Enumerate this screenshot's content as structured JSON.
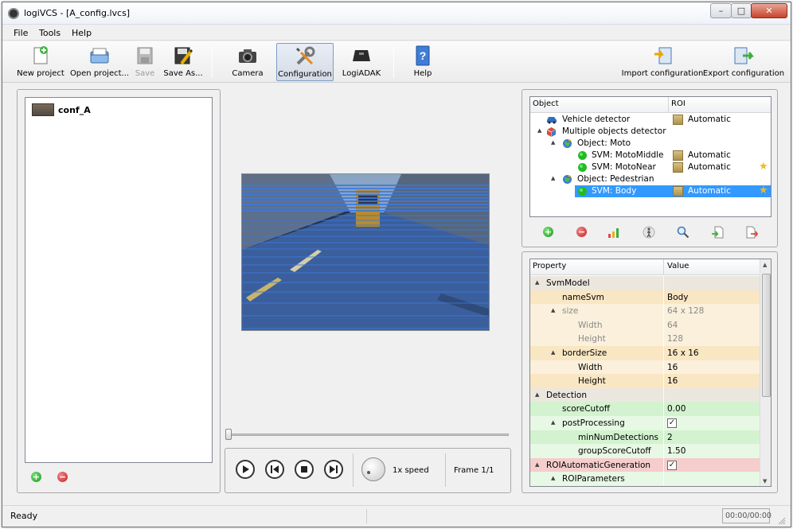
{
  "window": {
    "title": "logiVCS - [A_config.lvcs]",
    "minimize": "–",
    "maximize": "□",
    "close": "✕"
  },
  "menu": [
    "File",
    "Tools",
    "Help"
  ],
  "toolbar": {
    "new_project": "New project",
    "open_project": "Open project...",
    "save": "Save",
    "save_as": "Save As...",
    "camera": "Camera",
    "configuration": "Configuration",
    "logiadak": "LogiADAK",
    "help": "Help",
    "import_configuration": "Import configuration",
    "export_configuration": "Export configuration"
  },
  "projects": {
    "items": [
      {
        "label": "conf_A"
      }
    ]
  },
  "player": {
    "speed_label": "1x speed",
    "frame_label": "Frame 1/1",
    "slider_position": 0
  },
  "object_tree": {
    "headers": {
      "object": "Object",
      "roi": "ROI"
    },
    "rows": [
      {
        "label": "Vehicle detector",
        "roi": "Automatic"
      },
      {
        "label": "Multiple objects detector"
      },
      {
        "label": "Object: Moto"
      },
      {
        "label": "SVM: MotoMiddle",
        "roi": "Automatic"
      },
      {
        "label": "SVM: MotoNear",
        "roi": "Automatic"
      },
      {
        "label": "Object: Pedestrian"
      },
      {
        "label": "SVM: Body",
        "roi": "Automatic",
        "selected": true
      }
    ]
  },
  "properties": {
    "headers": {
      "property": "Property",
      "value": "Value"
    },
    "rows": [
      {
        "name": "SvmModel",
        "value": ""
      },
      {
        "name": "nameSvm",
        "value": "Body"
      },
      {
        "name": "size",
        "value": "64 x 128"
      },
      {
        "name": "Width",
        "value": "64"
      },
      {
        "name": "Height",
        "value": "128"
      },
      {
        "name": "borderSize",
        "value": "16 x 16"
      },
      {
        "name": "Width",
        "value": "16"
      },
      {
        "name": "Height",
        "value": "16"
      },
      {
        "name": "Detection",
        "value": ""
      },
      {
        "name": "scoreCutoff",
        "value": "0.00"
      },
      {
        "name": "postProcessing",
        "value": "",
        "checked": true
      },
      {
        "name": "minNumDetections",
        "value": "2"
      },
      {
        "name": "groupScoreCutoff",
        "value": "1.50"
      },
      {
        "name": "ROIAutomaticGeneration",
        "value": "",
        "checked": true
      },
      {
        "name": "ROIParameters",
        "value": ""
      }
    ],
    "checkmark": "✓"
  },
  "status": {
    "text": "Ready",
    "time": "00:00/00:00"
  },
  "colors": {
    "selection": "#3399ff",
    "roi_overlay": "#3c78dc"
  }
}
